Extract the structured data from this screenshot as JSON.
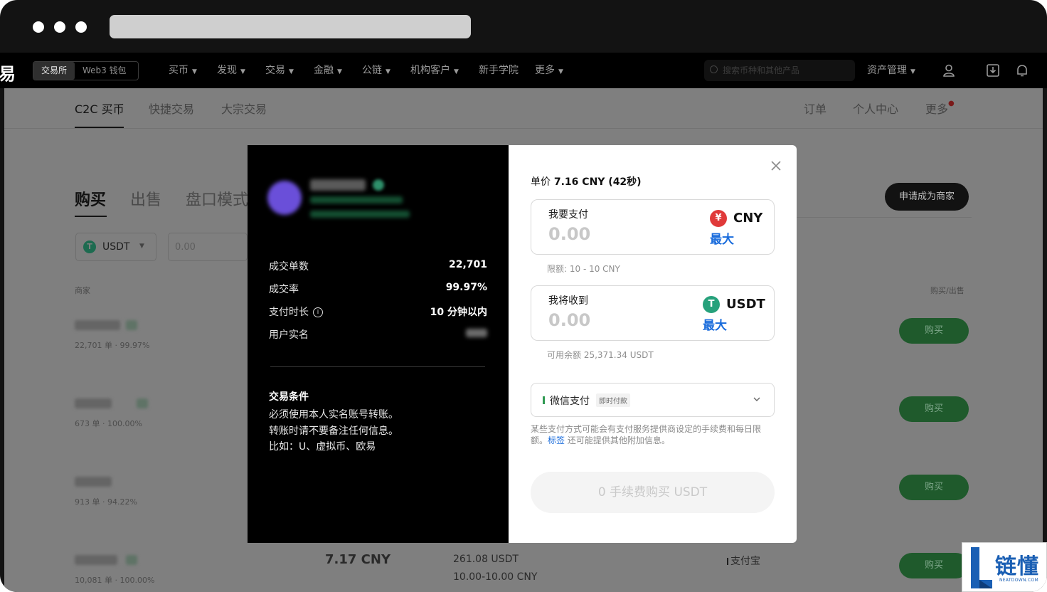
{
  "nav": {
    "logo_fragment": "易",
    "switch": [
      "交易所",
      "Web3 钱包"
    ],
    "items": [
      "买币",
      "发现",
      "交易",
      "金融",
      "公链",
      "机构客户",
      "新手学院",
      "更多"
    ],
    "search_placeholder": "搜索币种和其他产品",
    "asset_management": "资产管理"
  },
  "subnav": {
    "tabs": [
      "C2C 买币",
      "快捷交易",
      "大宗交易"
    ],
    "right": [
      "订单",
      "个人中心",
      "更多"
    ]
  },
  "trade": {
    "tabs": [
      "购买",
      "出售",
      "盘口模式"
    ],
    "become_merchant": "申请成为商家",
    "coin": "USDT",
    "amount_placeholder": "0.00",
    "col_merchant": "商家",
    "col_action": "购买/出售",
    "buy_label": "购买",
    "merchants": [
      {
        "stats": "22,701 单 · 99.97%"
      },
      {
        "stats": "673 单 · 100.00%"
      },
      {
        "stats": "913 单 · 94.22%"
      },
      {
        "stats": "10,081 单 · 100.00%",
        "price": "7.17 CNY",
        "available": "261.08 USDT",
        "limit": "10.00-10.00 CNY",
        "payment": "支付宝"
      }
    ]
  },
  "modal": {
    "stats": [
      {
        "label": "成交单数",
        "value": "22,701"
      },
      {
        "label": "成交率",
        "value": "99.97%"
      },
      {
        "label": "支付时长",
        "value": "10 分钟以内"
      },
      {
        "label": "用户实名",
        "value": ""
      }
    ],
    "terms_title": "交易条件",
    "terms": [
      "必须使用本人实名账号转账。",
      "转账时请不要备注任何信息。",
      "比如：U、虚拟币、欧易"
    ],
    "price_label": "单价",
    "price_value": "7.16 CNY (42秒)",
    "pay_label": "我要支付",
    "pay_value": "0.00",
    "pay_currency": "CNY",
    "max_label": "最大",
    "limit_hint": "限额: 10 - 10 CNY",
    "receive_label": "我将收到",
    "receive_value": "0.00",
    "receive_currency": "USDT",
    "balance_hint": "可用余额 25,371.34 USDT",
    "pay_method": "微信支付",
    "pay_method_tag": "即时付款",
    "note_before": "某些支付方式可能会有支付服务提供商设定的手续费和每日限额。",
    "note_link": "标签",
    "note_after": " 还可能提供其他附加信息。",
    "submit": "0 手续费购买 USDT"
  },
  "watermark": {
    "cn": "链懂",
    "en": "NEATDOWN.COM"
  },
  "colors": {
    "accent": "#1a6cdc",
    "buy_green": "#1f5a2c",
    "cny_red": "#e03a3a",
    "usdt_green": "#26a17b"
  }
}
